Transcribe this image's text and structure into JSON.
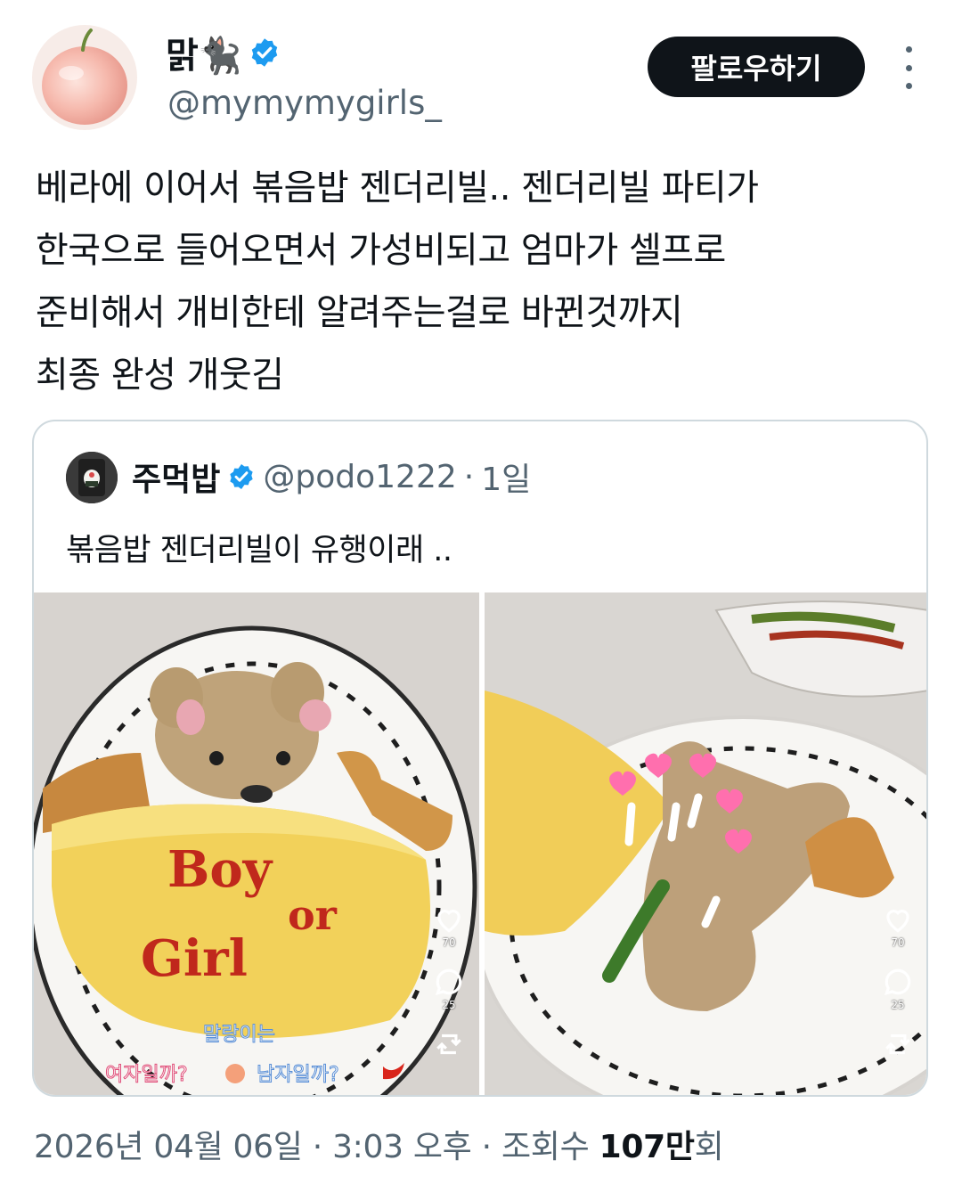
{
  "author": {
    "name": "맑🐈‍⬛",
    "handle": "@mymymygirls_",
    "verified": true,
    "avatar": "peach-apple-avatar"
  },
  "actions": {
    "follow_label": "팔로우하기",
    "more": "more-vertical-icon"
  },
  "tweet": {
    "text": "베라에 이어서 볶음밥 젠더리빌.. 젠더리빌 파티가\n한국으로 들어오면서 가성비되고 엄마가 셀프로\n준비해서 개비한테 알려주는걸로 바뀐것까지\n최종 완성 개웃김"
  },
  "quote": {
    "name": "주먹밥",
    "handle": "@podo1222",
    "separator": "·",
    "time": "1일",
    "text": "볶음밥 젠더리빌이 유행이래 ..",
    "media": [
      {
        "description_icon": "omelette-bear-rice-photo",
        "ketchup_text": [
          "Boy",
          "or",
          "Girl"
        ],
        "caption_line1": "말랑이는",
        "caption_line2_a": "여자일까?",
        "caption_line2_b": "남자일까?",
        "likes": "70",
        "comments": "25"
      },
      {
        "description_icon": "bear-rice-hearts-photo",
        "likes": "70",
        "comments": "25"
      }
    ]
  },
  "footer": {
    "date": "2026년 04월 06일",
    "sep1": "·",
    "time": "3:03 오후",
    "sep2": "·",
    "views_label": "조회수",
    "views_value": "107만",
    "views_suffix": "회"
  },
  "colors": {
    "verified": "#1d9bf0",
    "text_primary": "#0f1419",
    "text_secondary": "#536471",
    "border": "#cfd9de"
  }
}
